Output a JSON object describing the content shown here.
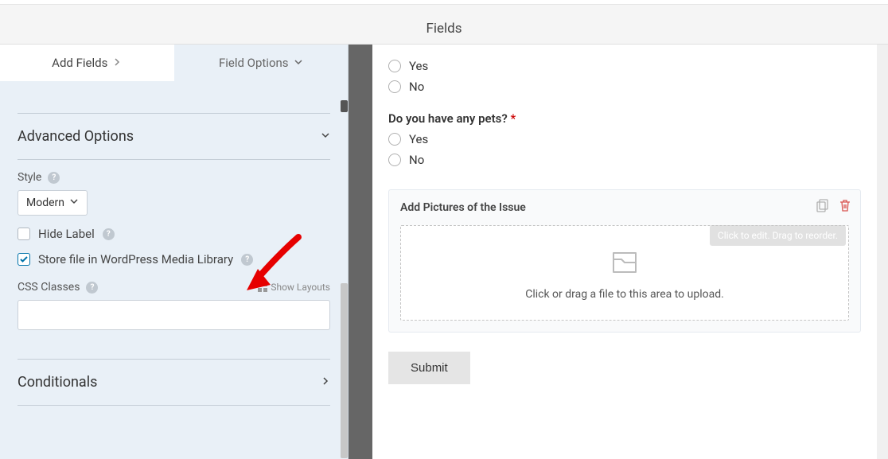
{
  "header": {
    "title": "Fields"
  },
  "tabs": {
    "add_fields": "Add Fields",
    "field_options": "Field Options"
  },
  "section": {
    "advanced": "Advanced Options",
    "conditionals": "Conditionals"
  },
  "style": {
    "label": "Style",
    "value": "Modern"
  },
  "hide_label": "Hide Label",
  "store_media": "Store file in WordPress Media Library",
  "css": {
    "label": "CSS Classes",
    "show_layouts": "Show Layouts"
  },
  "preview": {
    "radio1": {
      "yes": "Yes",
      "no": "No"
    },
    "question": "Do you have any pets?",
    "radio2": {
      "yes": "Yes",
      "no": "No"
    },
    "upload": {
      "title": "Add Pictures of the Issue",
      "tooltip": "Click to edit. Drag to reorder.",
      "dropzone_text": "Click or drag a file to this area to upload."
    },
    "submit": "Submit"
  }
}
